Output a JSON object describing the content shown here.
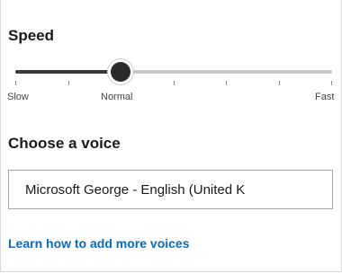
{
  "speed": {
    "title": "Speed",
    "labels": {
      "slow": "Slow",
      "normal": "Normal",
      "fast": "Fast"
    },
    "value": 0.333,
    "tick_count": 7
  },
  "voice": {
    "title": "Choose a voice",
    "selected": "Microsoft George - English (United K"
  },
  "links": {
    "learn_more": "Learn how to add more voices"
  },
  "colors": {
    "link": "#0a6bbd",
    "track": "#c8c8c8",
    "track_fill": "#3a3a3a",
    "thumb": "#2b2b2b"
  }
}
